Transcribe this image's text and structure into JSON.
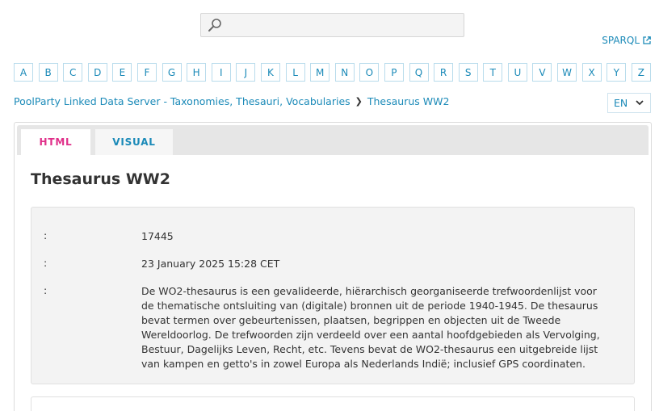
{
  "search": {
    "placeholder": "",
    "icon": "search-icon"
  },
  "header": {
    "sparql_label": "SPARQL"
  },
  "alphabet": [
    "A",
    "B",
    "C",
    "D",
    "E",
    "F",
    "G",
    "H",
    "I",
    "J",
    "K",
    "L",
    "M",
    "N",
    "O",
    "P",
    "Q",
    "R",
    "S",
    "T",
    "U",
    "V",
    "W",
    "X",
    "Y",
    "Z"
  ],
  "breadcrumb": {
    "root": "PoolParty Linked Data Server - Taxonomies, Thesauri, Vocabularies",
    "current": "Thesaurus WW2"
  },
  "language": {
    "selected": "EN"
  },
  "tabs": [
    {
      "label": "HTML",
      "active": true
    },
    {
      "label": "VISUAL",
      "active": false
    }
  ],
  "page": {
    "title": "Thesaurus WW2"
  },
  "properties": [
    {
      "key": ":",
      "value": "17445"
    },
    {
      "key": ":",
      "value": "23 January 2025 15:28 CET"
    },
    {
      "key": ":",
      "value": "De WO2-thesaurus is een gevalideerde, hiërarchisch georganiseerde trefwoordenlijst voor de thematische ontsluiting van (digitale) bronnen uit de periode 1940-1945. De thesaurus bevat termen over gebeurtenissen, plaatsen, begrippen en objecten uit de Tweede Wereldoorlog. De trefwoorden zijn verdeeld over een aantal hoofdgebieden als Vervolging, Bestuur, Dagelijks Leven, Recht, etc. Tevens bevat de WO2-thesaurus een uitgebreide lijst van kampen en getto's in zowel Europa als Nederlands Indië; inclusief GPS coordinaten."
    }
  ],
  "colors": {
    "link": "#1b8ab8",
    "active_tab": "#e0308a",
    "card_bg": "#f3f3f3"
  }
}
